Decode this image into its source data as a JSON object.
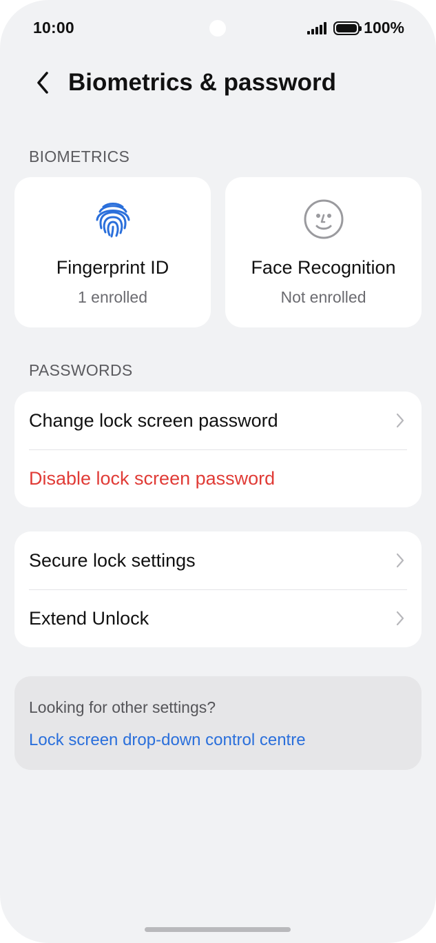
{
  "status_bar": {
    "time": "10:00",
    "battery_text": "100%",
    "battery_level": 1.0
  },
  "header": {
    "title": "Biometrics & password"
  },
  "biometrics": {
    "section_label": "BIOMETRICS",
    "cards": [
      {
        "title": "Fingerprint ID",
        "status": "1 enrolled",
        "icon": "fingerprint-icon",
        "icon_color": "#2a6fdb"
      },
      {
        "title": "Face Recognition",
        "status": "Not enrolled",
        "icon": "face-icon",
        "icon_color": "#9a9a9e"
      }
    ]
  },
  "passwords": {
    "section_label": "PASSWORDS",
    "items": [
      {
        "label": "Change lock screen password",
        "icon": "chevron-right-icon"
      },
      {
        "label": "Disable lock screen password",
        "color": "#e03b36"
      }
    ]
  },
  "security": {
    "items": [
      {
        "label": "Secure lock settings",
        "icon": "chevron-right-icon"
      },
      {
        "label": "Extend Unlock",
        "icon": "chevron-right-icon"
      }
    ]
  },
  "info": {
    "text": "Looking for other settings?",
    "link": "Lock screen drop-down control centre",
    "link_color": "#2a6fdb"
  }
}
